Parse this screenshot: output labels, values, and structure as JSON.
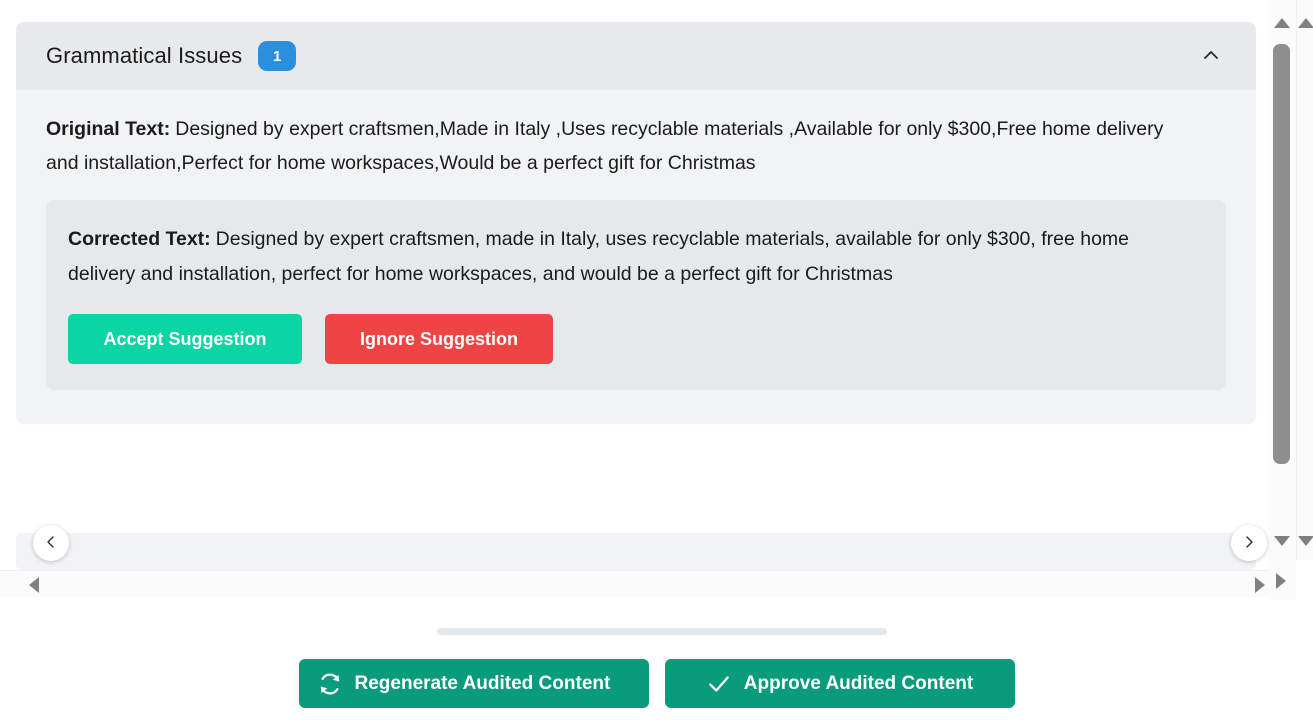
{
  "card": {
    "title": "Grammatical Issues",
    "issue_count": "1",
    "collapse_icon": "chevron-up-icon",
    "original_label": "Original Text:",
    "original_text": "Designed by expert craftsmen,Made in Italy ,Uses recyclable materials ,Available for only $300,Free home delivery and installation,Perfect for home workspaces,Would be a perfect gift for Christmas",
    "corrected_label": "Corrected Text:",
    "corrected_text": "Designed by expert craftsmen, made in Italy, uses recyclable materials, available for only $300, free home delivery and installation, perfect for home workspaces, and would be a perfect gift for Christmas",
    "accept_label": "Accept Suggestion",
    "ignore_label": "Ignore Suggestion"
  },
  "carousel": {
    "prev_icon": "chevron-left-icon",
    "next_icon": "chevron-right-icon"
  },
  "footer": {
    "regenerate_label": "Regenerate Audited Content",
    "regenerate_icon": "refresh-icon",
    "approve_label": "Approve Audited Content",
    "approve_icon": "check-icon"
  },
  "scrollbars": {
    "up_icon": "scroll-up-arrow-icon",
    "down_icon": "scroll-down-arrow-icon",
    "left_icon": "scroll-left-arrow-icon",
    "right_icon": "scroll-right-arrow-icon"
  },
  "colors": {
    "badge_blue": "#2b8fe0",
    "accept_green": "#0bd4a5",
    "ignore_red": "#ef4444",
    "footer_green": "#0a9b7d",
    "card_bg": "#f1f3f5",
    "header_bg": "#e7e9eb",
    "corrected_bg": "#e5e9ec"
  }
}
